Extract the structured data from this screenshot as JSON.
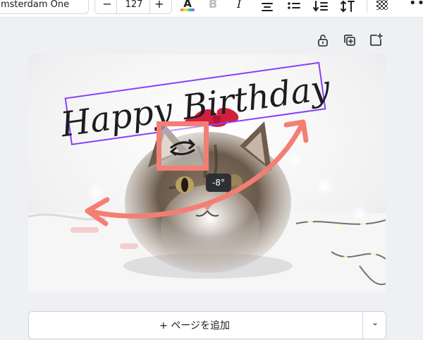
{
  "toolbar": {
    "font_name": "msterdam One",
    "font_size": "127",
    "minus": "−",
    "plus": "+",
    "text_color_letter": "A",
    "bold_letter": "B",
    "italic_letter": "I",
    "more": "•••"
  },
  "canvas": {
    "text": "Happy Birthday",
    "rotation_label": "-8°",
    "text_color": "#1c1d21",
    "selection_color": "#8b3dff",
    "annotation_color": "#f47e73"
  },
  "footer": {
    "add_page_label": "+ ページを追加",
    "chevron": "⌄"
  }
}
